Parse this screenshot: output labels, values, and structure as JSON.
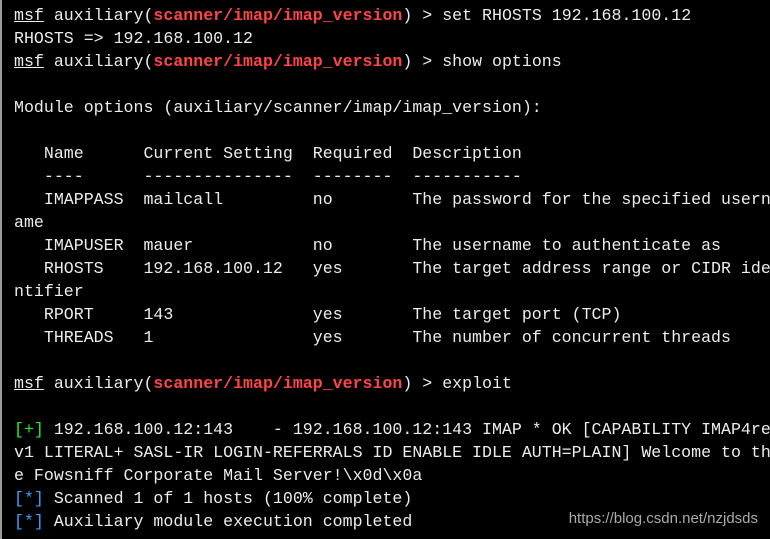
{
  "terminal": {
    "colors": {
      "text": "#ececec",
      "module": "#ff4444",
      "good": "#22ee22",
      "info": "#3fa0ff",
      "background": "#000000"
    },
    "lines": [
      [
        {
          "t": "msf",
          "s": "prompt"
        },
        {
          "t": " auxiliary("
        },
        {
          "t": "scanner/imap/imap_version",
          "s": "module"
        },
        {
          "t": ") > set RHOSTS 192.168.100.12"
        }
      ],
      [
        {
          "t": "RHOSTS => 192.168.100.12"
        }
      ],
      [
        {
          "t": "msf",
          "s": "prompt"
        },
        {
          "t": " auxiliary("
        },
        {
          "t": "scanner/imap/imap_version",
          "s": "module"
        },
        {
          "t": ") > show options"
        }
      ],
      [],
      [
        {
          "t": "Module options (auxiliary/scanner/imap/imap_version):"
        }
      ],
      [],
      [
        {
          "t": "   Name      Current Setting  Required  Description"
        }
      ],
      [
        {
          "t": "   ----      ---------------  --------  -----------"
        }
      ],
      [
        {
          "t": "   IMAPPASS  mailcall         no        The password for the specified usern"
        }
      ],
      [
        {
          "t": "ame"
        }
      ],
      [
        {
          "t": "   IMAPUSER  mauer            no        The username to authenticate as"
        }
      ],
      [
        {
          "t": "   RHOSTS    192.168.100.12   yes       The target address range or CIDR ide"
        }
      ],
      [
        {
          "t": "ntifier"
        }
      ],
      [
        {
          "t": "   RPORT     143              yes       The target port (TCP)"
        }
      ],
      [
        {
          "t": "   THREADS   1                yes       The number of concurrent threads"
        }
      ],
      [],
      [
        {
          "t": "msf",
          "s": "prompt"
        },
        {
          "t": " auxiliary("
        },
        {
          "t": "scanner/imap/imap_version",
          "s": "module"
        },
        {
          "t": ") > exploit"
        }
      ],
      [],
      [
        {
          "t": "[+]",
          "s": "good"
        },
        {
          "t": " 192.168.100.12:143    - 192.168.100.12:143 IMAP * OK [CAPABILITY IMAP4re"
        }
      ],
      [
        {
          "t": "v1 LITERAL+ SASL-IR LOGIN-REFERRALS ID ENABLE IDLE AUTH=PLAIN] Welcome to th"
        }
      ],
      [
        {
          "t": "e Fowsniff Corporate Mail Server!\\x0d\\x0a"
        }
      ],
      [
        {
          "t": "[*]",
          "s": "info"
        },
        {
          "t": " Scanned 1 of 1 hosts (100% complete)"
        }
      ],
      [
        {
          "t": "[*]",
          "s": "info"
        },
        {
          "t": " Auxiliary module execution completed"
        }
      ]
    ]
  },
  "watermark": "https://blog.csdn.net/nzjdsds"
}
